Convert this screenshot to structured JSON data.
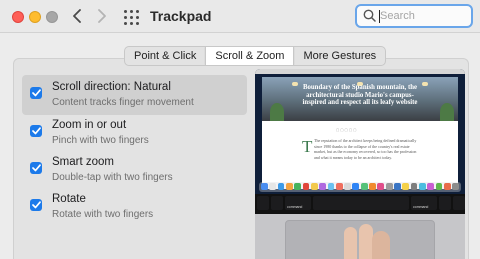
{
  "window": {
    "title": "Trackpad"
  },
  "search": {
    "placeholder": "Search",
    "value": ""
  },
  "tabs": [
    {
      "label": "Point & Click",
      "active": false
    },
    {
      "label": "Scroll & Zoom",
      "active": true
    },
    {
      "label": "More Gestures",
      "active": false
    }
  ],
  "options": [
    {
      "title": "Scroll direction: Natural",
      "description": "Content tracks finger movement",
      "checked": true,
      "selected": true
    },
    {
      "title": "Zoom in or out",
      "description": "Pinch with two fingers",
      "checked": true,
      "selected": false
    },
    {
      "title": "Smart zoom",
      "description": "Double-tap with two fingers",
      "checked": true,
      "selected": false
    },
    {
      "title": "Rotate",
      "description": "Rotate with two fingers",
      "checked": true,
      "selected": false
    }
  ],
  "preview": {
    "headline": "Boundary of the Spanish mountain, the architectural studio Mario's campus-inspired and respect all its leafy website",
    "body": "The reputation of the architect keeps being defined dramatically since 1980 thanks to the collapse of the country's real estate market, but as the economy recovered, so too has the profession and what it means today to be an architect today.",
    "dropcap": "T",
    "keys": {
      "command_left": "command",
      "command_right": "command"
    }
  },
  "colors": {
    "accent": "#1c7aea",
    "search_focus": "#6aa6ea",
    "close": "#fe5f57",
    "minimize": "#febc2e",
    "maximize": "#a7a7a7"
  }
}
